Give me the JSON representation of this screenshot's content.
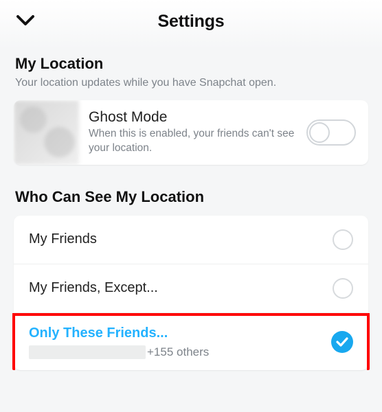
{
  "header": {
    "title": "Settings"
  },
  "myLocation": {
    "heading": "My Location",
    "subtitle": "Your location updates while you have Snapchat open.",
    "ghostMode": {
      "title": "Ghost Mode",
      "desc": "When this is enabled, your friends can't see your location.",
      "enabled": false
    }
  },
  "whoCanSee": {
    "heading": "Who Can See My Location",
    "options": [
      {
        "label": "My Friends",
        "selected": false
      },
      {
        "label": "My Friends, Except...",
        "selected": false
      },
      {
        "label": "Only These Friends...",
        "selected": true,
        "othersCount": "+155 others"
      }
    ]
  }
}
